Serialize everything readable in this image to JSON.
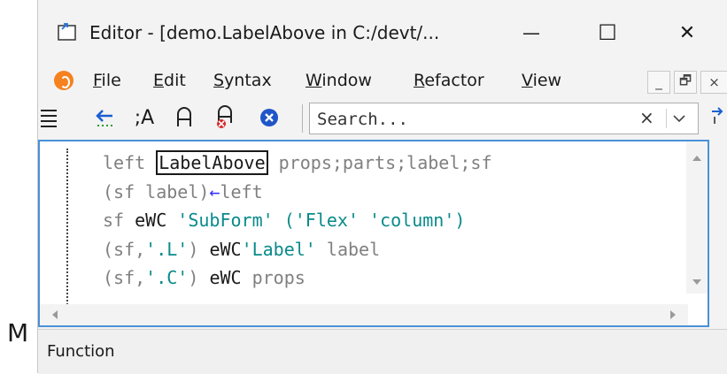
{
  "background_fragment": "M",
  "window": {
    "title": "Editor - [demo.LabelAbove in C:/devt/...",
    "controls": {
      "minimize": "—",
      "maximize": "☐",
      "close": "✕"
    }
  },
  "menu": {
    "items": [
      {
        "label": "File",
        "underline": "F",
        "rest": "ile"
      },
      {
        "label": "Edit",
        "underline": "E",
        "rest": "dit"
      },
      {
        "label": "Syntax",
        "underline": "S",
        "rest": "yntax"
      },
      {
        "label": "Window",
        "underline": "W",
        "rest": "indow"
      },
      {
        "label": "Refactor",
        "underline": "R",
        "rest": "efactor"
      },
      {
        "label": "View",
        "underline": "V",
        "rest": "iew"
      }
    ],
    "mdi": {
      "minimize": "_",
      "restore": "🗗",
      "close": "×"
    }
  },
  "toolbar": {
    "comment_label": ";A",
    "search": {
      "placeholder": "Search...",
      "value": "",
      "clear": "×"
    }
  },
  "editor": {
    "lines": [
      [
        {
          "t": "left ",
          "c": ""
        },
        {
          "t": "LabelAbove",
          "c": "cur"
        },
        {
          "t": " props;parts;label;sf",
          "c": ""
        }
      ],
      [
        {
          "t": "(sf label)",
          "c": ""
        },
        {
          "t": "←",
          "c": "op"
        },
        {
          "t": "left",
          "c": ""
        }
      ],
      [
        {
          "t": "sf ",
          "c": ""
        },
        {
          "t": "eWC",
          "c": "kw"
        },
        {
          "t": " ",
          "c": ""
        },
        {
          "t": "'SubForm' ('Flex' 'column')",
          "c": "str"
        }
      ],
      [
        {
          "t": "(sf,",
          "c": ""
        },
        {
          "t": "'.L'",
          "c": "str"
        },
        {
          "t": ") ",
          "c": ""
        },
        {
          "t": "eWC",
          "c": "kw"
        },
        {
          "t": "'Label'",
          "c": "str"
        },
        {
          "t": " label",
          "c": ""
        }
      ],
      [
        {
          "t": "(sf,",
          "c": ""
        },
        {
          "t": "'.C'",
          "c": "str"
        },
        {
          "t": ") ",
          "c": ""
        },
        {
          "t": "eWC",
          "c": "kw"
        },
        {
          "t": " props",
          "c": ""
        }
      ]
    ]
  },
  "status": {
    "text": "Function"
  },
  "colors": {
    "accent": "#4a90d9",
    "string": "#0a8a8a",
    "assign": "#2a2aff",
    "logo": "#f5821f",
    "keyword": "#1a1a1a"
  }
}
